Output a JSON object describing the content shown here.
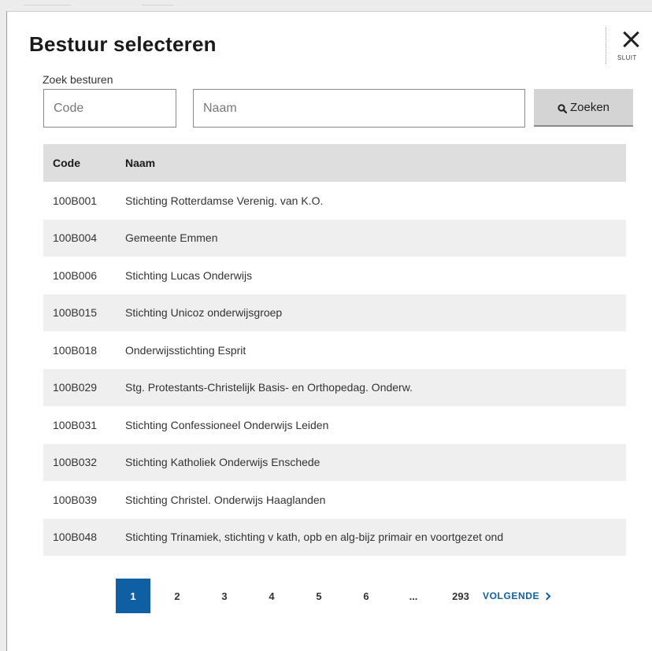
{
  "modal": {
    "title": "Bestuur selecteren",
    "close_label": "SLUIT"
  },
  "search": {
    "label": "Zoek besturen",
    "code_placeholder": "Code",
    "name_placeholder": "Naam",
    "button_label": "Zoeken",
    "button_icon": "search-icon"
  },
  "table": {
    "headers": {
      "code": "Code",
      "name": "Naam"
    },
    "rows": [
      {
        "code": "100B001",
        "name": "Stichting Rotterdamse Verenig. van K.O."
      },
      {
        "code": "100B004",
        "name": "Gemeente Emmen"
      },
      {
        "code": "100B006",
        "name": "Stichting Lucas Onderwijs"
      },
      {
        "code": "100B015",
        "name": "Stichting Unicoz onderwijsgroep"
      },
      {
        "code": "100B018",
        "name": "Onderwijsstichting Esprit"
      },
      {
        "code": "100B029",
        "name": "Stg. Protestants-Christelijk Basis- en Orthopedag. Onderw."
      },
      {
        "code": "100B031",
        "name": "Stichting Confessioneel Onderwijs Leiden"
      },
      {
        "code": "100B032",
        "name": "Stichting Katholiek Onderwijs Enschede"
      },
      {
        "code": "100B039",
        "name": "Stichting Christel. Onderwijs Haaglanden"
      },
      {
        "code": "100B048",
        "name": "Stichting Trinamiek, stichting v kath, opb en alg-bijz primair en voortgezet ond"
      }
    ]
  },
  "pagination": {
    "pages": [
      "1",
      "2",
      "3",
      "4",
      "5",
      "6"
    ],
    "current": "1",
    "ellipsis": "...",
    "last": "293",
    "next_label": "VOLGENDE"
  },
  "colors": {
    "accent": "#0f5fa5",
    "header_bg": "#dedede",
    "row_alt_bg": "#efefef",
    "button_bg": "#d4d4d4"
  }
}
